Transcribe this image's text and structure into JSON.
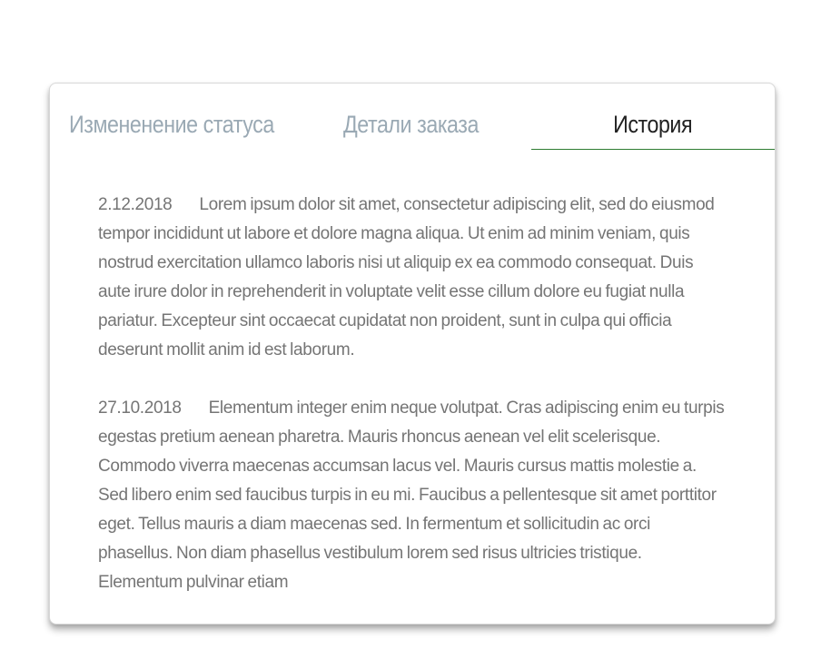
{
  "tabs": {
    "status": "Измененение статуса",
    "details": "Детали заказа",
    "history": "История"
  },
  "accent_color": "#2e7d32",
  "history": {
    "entries": [
      {
        "date": "2.12.2018",
        "text": "Lorem ipsum dolor sit amet, consectetur adipiscing elit, sed do eiusmod tempor incididunt ut labore et dolore magna aliqua. Ut enim ad minim veniam, quis nostrud exercitation ullamco laboris nisi ut aliquip ex ea commodo consequat. Duis aute irure dolor in reprehenderit in voluptate velit esse cillum dolore eu fugiat nulla pariatur. Excepteur sint occaecat cupidatat non proident, sunt in culpa qui officia deserunt mollit anim id est laborum."
      },
      {
        "date": "27.10.2018",
        "text": "Elementum integer enim neque volutpat. Cras adipiscing enim eu turpis egestas pretium aenean pharetra. Mauris rhoncus aenean vel elit scelerisque. Commodo viverra maecenas accumsan lacus vel. Mauris cursus mattis molestie a. Sed libero enim sed faucibus turpis in eu mi. Faucibus a pellentesque sit amet porttitor eget. Tellus mauris a diam maecenas sed. In fermentum et sollicitudin ac orci phasellus. Non diam phasellus vestibulum lorem sed risus ultricies tristique. Elementum pulvinar etiam"
      }
    ]
  }
}
